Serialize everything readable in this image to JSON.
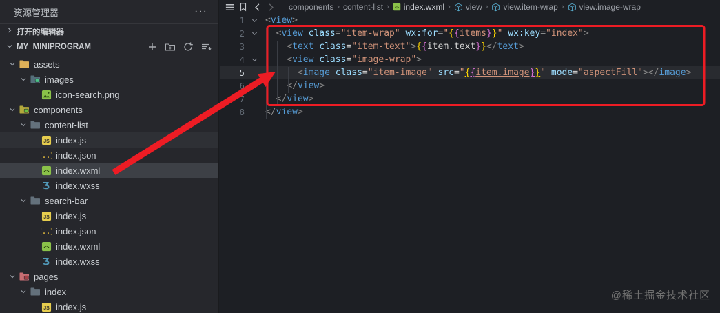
{
  "colors": {
    "annotation_red": "#ed1c24",
    "tag": "#569cd6",
    "attribute": "#9cdcfe",
    "string": "#ce9178",
    "punctuation": "#8a8a8a",
    "bracket_gold": "#ffd602",
    "bracket_pink": "#da70d6",
    "text": "#d4d4d4",
    "sidebar_bg": "#26272c",
    "editor_bg": "#1d1f24",
    "selected_row": "#3d4046"
  },
  "sidebar": {
    "title": "资源管理器",
    "more_label": "···",
    "open_editors": "打开的编辑器",
    "project": "MY_MINIPROGRAM",
    "action_icons": [
      "new-file-icon",
      "new-folder-icon",
      "refresh-icon",
      "collapse-all-icon"
    ],
    "tree": [
      {
        "label": "assets",
        "level": 1,
        "kind": "folder",
        "color": "#deb058",
        "badge": null,
        "expanded": true,
        "state": "none"
      },
      {
        "label": "images",
        "level": 2,
        "kind": "folder",
        "color": "#55707b",
        "badge": "#4cc38a",
        "expanded": true,
        "state": "none"
      },
      {
        "label": "icon-search.png",
        "level": 3,
        "kind": "png",
        "state": "none"
      },
      {
        "label": "components",
        "level": 1,
        "kind": "folder",
        "color": "#b3a93c",
        "badge": "#6abf40",
        "expanded": true,
        "state": "none"
      },
      {
        "label": "content-list",
        "level": 2,
        "kind": "folder",
        "color": "#64717c",
        "badge": null,
        "expanded": true,
        "state": "none"
      },
      {
        "label": "index.js",
        "level": 3,
        "kind": "js",
        "state": "opened"
      },
      {
        "label": "index.json",
        "level": 3,
        "kind": "json",
        "state": "none"
      },
      {
        "label": "index.wxml",
        "level": 3,
        "kind": "wxml",
        "state": "selected"
      },
      {
        "label": "index.wxss",
        "level": 3,
        "kind": "wxss",
        "state": "none"
      },
      {
        "label": "search-bar",
        "level": 2,
        "kind": "folder",
        "color": "#64717c",
        "badge": null,
        "expanded": true,
        "state": "none"
      },
      {
        "label": "index.js",
        "level": 3,
        "kind": "js",
        "state": "none"
      },
      {
        "label": "index.json",
        "level": 3,
        "kind": "json",
        "state": "none"
      },
      {
        "label": "index.wxml",
        "level": 3,
        "kind": "wxml",
        "state": "none"
      },
      {
        "label": "index.wxss",
        "level": 3,
        "kind": "wxss",
        "state": "none"
      },
      {
        "label": "pages",
        "level": 1,
        "kind": "folder",
        "color": "#c76e73",
        "badge": "#a33f46",
        "expanded": true,
        "state": "none"
      },
      {
        "label": "index",
        "level": 2,
        "kind": "folder",
        "color": "#64717c",
        "badge": null,
        "expanded": true,
        "state": "none"
      },
      {
        "label": "index.js",
        "level": 3,
        "kind": "js",
        "state": "none"
      }
    ]
  },
  "editor": {
    "breadcrumbs": [
      {
        "label": "components",
        "icon": null
      },
      {
        "label": "content-list",
        "icon": null
      },
      {
        "label": "index.wxml",
        "icon": "wxml-file-icon",
        "file": true
      },
      {
        "label": "view",
        "icon": "cube-symbol-icon"
      },
      {
        "label": "view.item-wrap",
        "icon": "cube-symbol-icon"
      },
      {
        "label": "view.image-wrap",
        "icon": "cube-symbol-icon"
      }
    ],
    "lines": [
      {
        "num": "1",
        "fold": true,
        "active": false,
        "tokens": [
          [
            "p",
            "<"
          ],
          [
            "tag",
            "view"
          ],
          [
            "p",
            ">"
          ]
        ]
      },
      {
        "num": "2",
        "fold": true,
        "active": false,
        "tokens": [
          [
            "ws",
            "  "
          ],
          [
            "p",
            "<"
          ],
          [
            "tag",
            "view"
          ],
          [
            "ws",
            " "
          ],
          [
            "attr",
            "class"
          ],
          [
            "eq",
            "="
          ],
          [
            "str",
            "\"item-wrap\""
          ],
          [
            "ws",
            " "
          ],
          [
            "attr",
            "wx:for"
          ],
          [
            "eq",
            "="
          ],
          [
            "str",
            "\""
          ],
          [
            "b1",
            "{"
          ],
          [
            "b2",
            "{"
          ],
          [
            "str",
            "items"
          ],
          [
            "b2",
            "}"
          ],
          [
            "b1",
            "}"
          ],
          [
            "str",
            "\""
          ],
          [
            "ws",
            " "
          ],
          [
            "attr",
            "wx:key"
          ],
          [
            "eq",
            "="
          ],
          [
            "str",
            "\"index\""
          ],
          [
            "p",
            ">"
          ]
        ]
      },
      {
        "num": "3",
        "fold": false,
        "active": false,
        "tokens": [
          [
            "ws",
            "    "
          ],
          [
            "p",
            "<"
          ],
          [
            "tag",
            "text"
          ],
          [
            "ws",
            " "
          ],
          [
            "attr",
            "class"
          ],
          [
            "eq",
            "="
          ],
          [
            "str",
            "\"item-text\""
          ],
          [
            "p",
            ">"
          ],
          [
            "b1",
            "{"
          ],
          [
            "b2",
            "{"
          ],
          [
            "txt",
            "item.text"
          ],
          [
            "b2",
            "}"
          ],
          [
            "b1",
            "}"
          ],
          [
            "p",
            "</"
          ],
          [
            "tag",
            "text"
          ],
          [
            "p",
            ">"
          ]
        ]
      },
      {
        "num": "4",
        "fold": true,
        "active": false,
        "tokens": [
          [
            "ws",
            "    "
          ],
          [
            "p",
            "<"
          ],
          [
            "tag",
            "view"
          ],
          [
            "ws",
            " "
          ],
          [
            "attr",
            "class"
          ],
          [
            "eq",
            "="
          ],
          [
            "str",
            "\"image-wrap\""
          ],
          [
            "p",
            ">"
          ]
        ]
      },
      {
        "num": "5",
        "fold": false,
        "active": true,
        "tokens": [
          [
            "ws",
            "      "
          ],
          [
            "p",
            "<"
          ],
          [
            "tag",
            "image"
          ],
          [
            "ws",
            " "
          ],
          [
            "attr",
            "class"
          ],
          [
            "eq",
            "="
          ],
          [
            "str",
            "\"item-image\""
          ],
          [
            "ws",
            " "
          ],
          [
            "attr",
            "src"
          ],
          [
            "eq",
            "="
          ],
          [
            "str",
            "\""
          ],
          [
            "b1 u",
            "{"
          ],
          [
            "b2 u",
            "{"
          ],
          [
            "str u",
            "item.image"
          ],
          [
            "b2 u",
            "}"
          ],
          [
            "b1 u",
            "}"
          ],
          [
            "str",
            "\""
          ],
          [
            "ws",
            " "
          ],
          [
            "attr",
            "mode"
          ],
          [
            "eq",
            "="
          ],
          [
            "str",
            "\"aspectFill\""
          ],
          [
            "p",
            ">"
          ],
          [
            "p",
            "</"
          ],
          [
            "tag",
            "image"
          ],
          [
            "p",
            ">"
          ]
        ]
      },
      {
        "num": "6",
        "fold": false,
        "active": false,
        "tokens": [
          [
            "ws",
            "    "
          ],
          [
            "p",
            "</"
          ],
          [
            "tag",
            "view"
          ],
          [
            "p",
            ">"
          ]
        ]
      },
      {
        "num": "7",
        "fold": false,
        "active": false,
        "tokens": [
          [
            "ws",
            "  "
          ],
          [
            "p",
            "</"
          ],
          [
            "tag",
            "view"
          ],
          [
            "p",
            ">"
          ]
        ]
      },
      {
        "num": "8",
        "fold": false,
        "active": false,
        "tokens": [
          [
            "p",
            "</"
          ],
          [
            "tag",
            "view"
          ],
          [
            "p",
            ">"
          ]
        ]
      }
    ]
  },
  "annotations": {
    "watermark": "@稀土掘金技术社区"
  }
}
